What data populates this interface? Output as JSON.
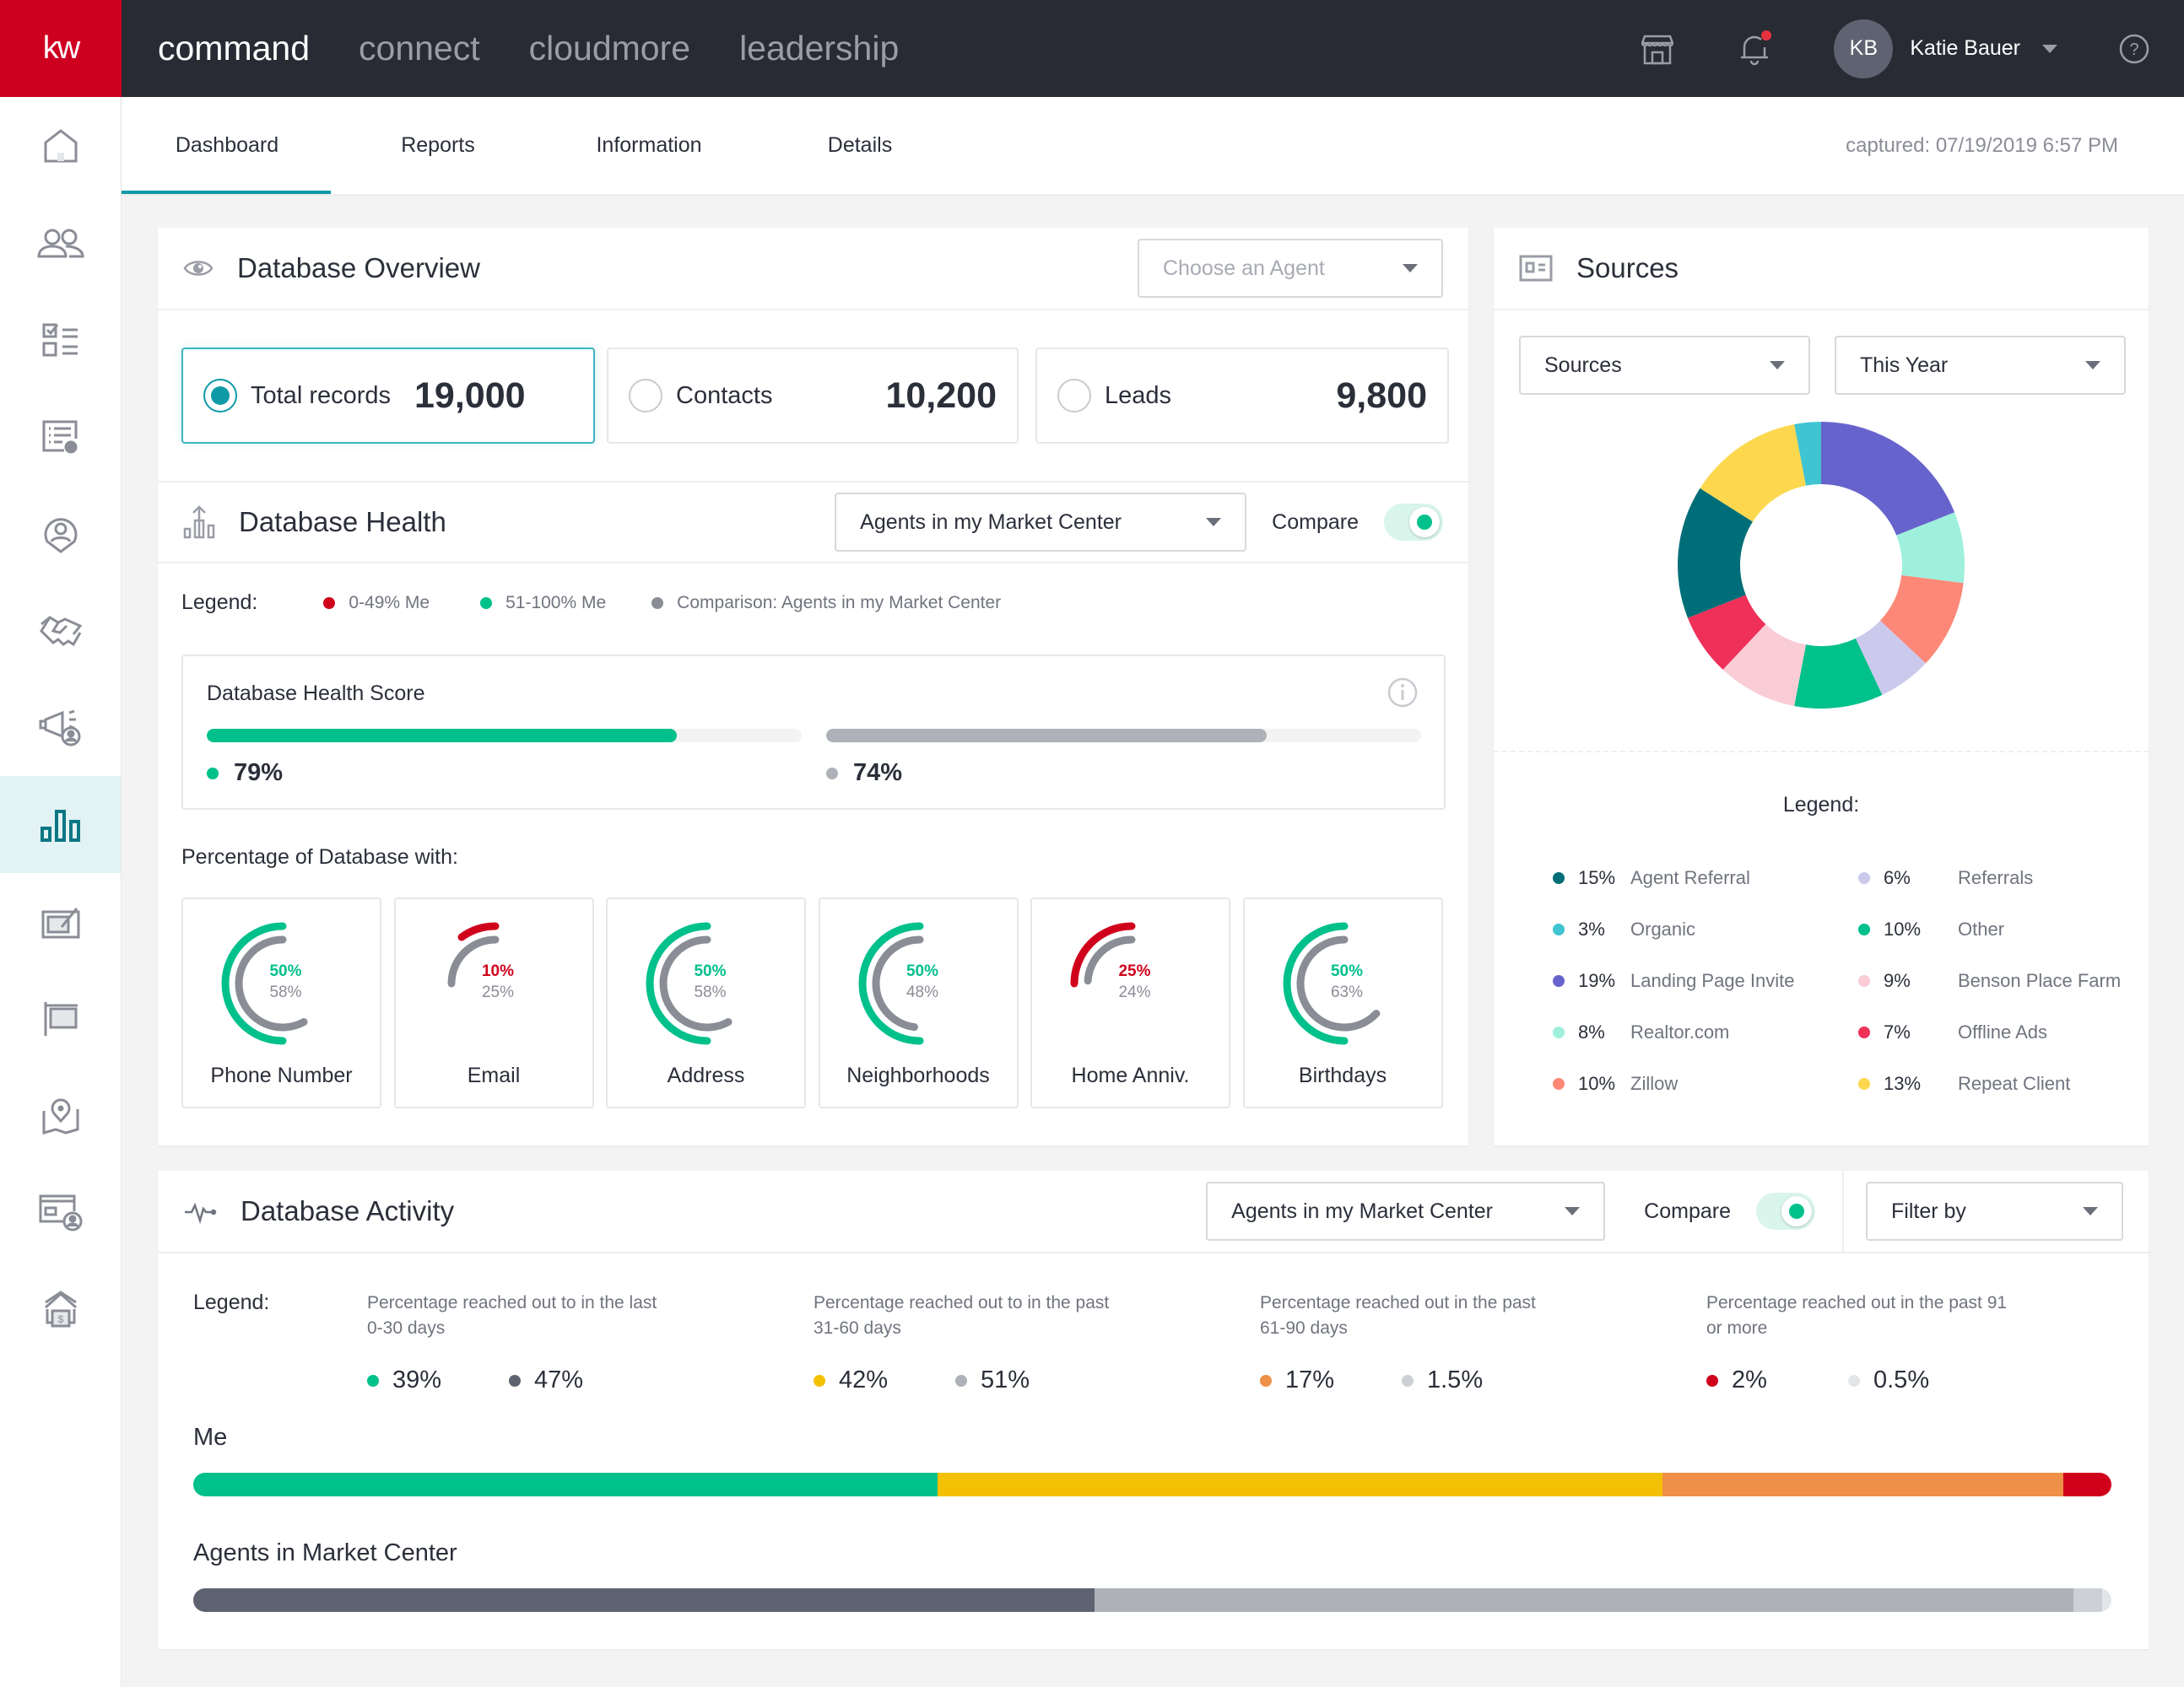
{
  "topbar": {
    "logo": "kw",
    "apps": [
      "command",
      "connect",
      "cloudmore",
      "leadership"
    ],
    "active_app": "command",
    "user_initials": "KB",
    "user_name": "Katie Bauer",
    "notification_dot_color": "#e8313f"
  },
  "sidebar": {
    "items": [
      "home-icon",
      "people-icon",
      "checklist-icon",
      "settings-doc-icon",
      "location-person-icon",
      "handshake-icon",
      "megaphone-icon",
      "bar-chart-icon",
      "edit-board-icon",
      "signpost-icon",
      "map-pin-icon",
      "id-card-icon",
      "house-dollar-icon"
    ],
    "active_index": 7
  },
  "subnav": {
    "tabs": [
      "Dashboard",
      "Reports",
      "Information",
      "Details"
    ],
    "active_tab": "Dashboard",
    "captured": "captured: 07/19/2019 6:57 PM"
  },
  "overview": {
    "title": "Database Overview",
    "agent_placeholder": "Choose an Agent",
    "stats": [
      {
        "label": "Total records",
        "value": "19,000",
        "selected": true
      },
      {
        "label": "Contacts",
        "value": "10,200",
        "selected": false
      },
      {
        "label": "Leads",
        "value": "9,800",
        "selected": false
      }
    ]
  },
  "health": {
    "title": "Database Health",
    "compare_select": "Agents in my Market Center",
    "compare_label": "Compare",
    "compare_on": true,
    "legend_label": "Legend:",
    "legend": [
      {
        "label": "0-49% Me",
        "color": "#d0021b"
      },
      {
        "label": "51-100% Me",
        "color": "#00c08b"
      },
      {
        "label": "Comparison: Agents in my Market Center",
        "color": "#8a8d96"
      }
    ],
    "score_title": "Database Health Score",
    "score_me": {
      "value": 79,
      "label": "79%",
      "color": "#00c08b"
    },
    "score_compare": {
      "value": 74,
      "label": "74%",
      "color": "#aeb1b8"
    },
    "pct_title": "Percentage of Database with:",
    "gauges": [
      {
        "label": "Phone Number",
        "me": 50,
        "me_label": "50%",
        "compare": 58,
        "compare_label": "58%"
      },
      {
        "label": "Email",
        "me": 10,
        "me_label": "10%",
        "compare": 25,
        "compare_label": "25%"
      },
      {
        "label": "Address",
        "me": 50,
        "me_label": "50%",
        "compare": 58,
        "compare_label": "58%"
      },
      {
        "label": "Neighborhoods",
        "me": 50,
        "me_label": "50%",
        "compare": 48,
        "compare_label": "48%"
      },
      {
        "label": "Home Anniv.",
        "me": 25,
        "me_label": "25%",
        "compare": 24,
        "compare_label": "24%"
      },
      {
        "label": "Birthdays",
        "me": 50,
        "me_label": "50%",
        "compare": 63,
        "compare_label": "63%"
      }
    ]
  },
  "sources": {
    "title": "Sources",
    "select_type": "Sources",
    "select_period": "This Year",
    "legend_label": "Legend:",
    "legend": [
      {
        "pct": "15%",
        "name": "Agent Referral",
        "color": "#006e78"
      },
      {
        "pct": "3%",
        "name": "Organic",
        "color": "#3fc4d2"
      },
      {
        "pct": "19%",
        "name": "Landing Page Invite",
        "color": "#6763cd"
      },
      {
        "pct": "8%",
        "name": "Realtor.com",
        "color": "#9ef0dc"
      },
      {
        "pct": "10%",
        "name": "Zillow",
        "color": "#fd8878"
      },
      {
        "pct": "6%",
        "name": "Referrals",
        "color": "#cbc9ec"
      },
      {
        "pct": "10%",
        "name": "Other",
        "color": "#00c08b"
      },
      {
        "pct": "9%",
        "name": "Benson Place Farm",
        "color": "#f9ccd6"
      },
      {
        "pct": "7%",
        "name": "Offline Ads",
        "color": "#ef3059"
      },
      {
        "pct": "13%",
        "name": "Repeat Client",
        "color": "#fdd84e"
      }
    ]
  },
  "chart_data": {
    "type": "pie",
    "title": "Sources",
    "donut": true,
    "categories": [
      "Landing Page Invite",
      "Realtor.com",
      "Zillow",
      "Referrals",
      "Other",
      "Benson Place Farm",
      "Offline Ads",
      "Agent Referral",
      "Repeat Client",
      "Organic"
    ],
    "values": [
      19,
      8,
      10,
      6,
      10,
      9,
      7,
      15,
      13,
      3
    ],
    "colors": [
      "#6763cd",
      "#9ef0dc",
      "#fd8878",
      "#cbc9ec",
      "#00c08b",
      "#f9ccd6",
      "#ef3059",
      "#006e78",
      "#fdd84e",
      "#3fc4d2"
    ],
    "legend": "bottom"
  },
  "activity": {
    "title": "Database Activity",
    "compare_select": "Agents in my Market Center",
    "compare_label": "Compare",
    "compare_on": true,
    "filter_placeholder": "Filter by",
    "legend_label": "Legend:",
    "groups": [
      {
        "text": "Percentage reached out to in the last 0-30 days",
        "me": "39%",
        "me_color": "#00c08b",
        "compare": "47%",
        "compare_color": "#5f6371"
      },
      {
        "text": "Percentage reached out to in the past 31-60 days",
        "me": "42%",
        "me_color": "#f4c003",
        "compare": "51%",
        "compare_color": "#aeb1b8"
      },
      {
        "text": "Percentage reached out in the past 61-90 days",
        "me": "17%",
        "me_color": "#ee9048",
        "compare": "1.5%",
        "compare_color": "#cdd1d5"
      },
      {
        "text": "Percentage reached out in the past 91 or more",
        "me": "2%",
        "me_color": "#d0021b",
        "compare": "0.5%",
        "compare_color": "#e3e6e9"
      }
    ],
    "me_label": "Me",
    "compare_bar_label": "Agents in Market Center",
    "me_segments": [
      39,
      38,
      21,
      2.5
    ],
    "compare_segments": [
      47,
      51,
      1.5,
      0.5
    ]
  }
}
